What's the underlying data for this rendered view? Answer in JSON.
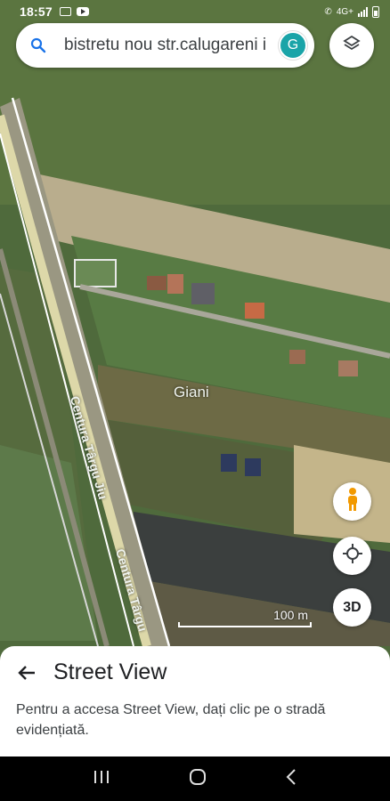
{
  "status_bar": {
    "time": "18:57",
    "network": "4G+"
  },
  "search": {
    "value": "bistretu nou str.calugareni i",
    "avatar_letter": "G"
  },
  "map": {
    "place_label": "Giani",
    "road_label_1": "Centura Târgu Jiu",
    "road_label_2": "Centura Târgu",
    "scale_label": "100 m"
  },
  "controls": {
    "three_d_label": "3D"
  },
  "bottom_sheet": {
    "title": "Street View",
    "description": "Pentru a accesa Street View, dați clic pe o stradă evidențiată."
  },
  "icons": [
    "search-icon",
    "layers-icon",
    "pegman-icon",
    "my-location-icon",
    "back-arrow-icon",
    "recents-icon",
    "home-icon",
    "nav-back-icon"
  ],
  "colors": {
    "avatar": "#1aa4a8",
    "pegman": "#f29900",
    "road_outline": "#c9c9c9"
  }
}
